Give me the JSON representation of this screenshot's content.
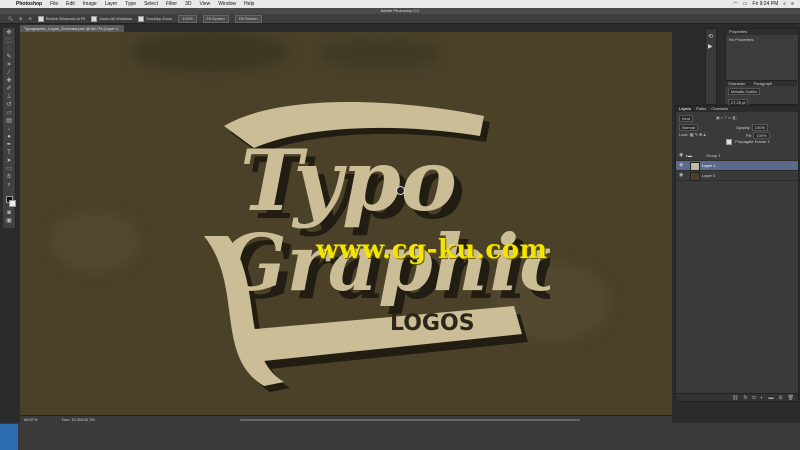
{
  "menubar": {
    "app": "Photoshop",
    "menus": [
      "File",
      "Edit",
      "Image",
      "Layer",
      "Type",
      "Select",
      "Filter",
      "3D",
      "View",
      "Window",
      "Help"
    ],
    "clock": "Fri 9:24 PM"
  },
  "window": {
    "title": "Adobe Photoshop CC"
  },
  "options": {
    "resize_windows": "Resize Windows to Fit",
    "zoom_all": "Zoom All Windows",
    "scrubby_zoom": "Scrubby Zoom",
    "btn_100": "100%",
    "btn_fit": "Fit Screen",
    "btn_fill": "Fill Screen"
  },
  "document": {
    "tab": "Typographic_Logos_Overcast.psd @ 66.7% (Layer 1, RGB/8) *",
    "zoom": "66.67%",
    "doc_size": "Doc: 10.0M/30.7M"
  },
  "artwork": {
    "line1": "Typo",
    "line2": "Graphic",
    "line3": "LOGOS",
    "colors": {
      "cream": "#cbbe96",
      "shadow": "#1f1c12",
      "background": "#4a4128"
    }
  },
  "watermark": {
    "text": "www.cg-ku.com",
    "color": "#f5e300"
  },
  "properties_panel": {
    "title": "Properties",
    "empty": "No Properties"
  },
  "character_panel": {
    "tabs": [
      "Character",
      "Paragraph"
    ],
    "font": "Metallic Gothic",
    "size": "27.25 pt"
  },
  "layers_panel": {
    "tabs": [
      "Layers",
      "Paths",
      "Channels"
    ],
    "kind_filter": "Kind",
    "blend_mode": "Normal",
    "opacity_label": "Opacity:",
    "opacity_value": "100%",
    "lock_label": "Lock:",
    "fill_label": "Fill:",
    "fill_value": "100%",
    "propagate": "Propagate Frame 1",
    "layers": [
      {
        "name": "Group 1",
        "selected": false
      },
      {
        "name": "Layer 1",
        "selected": true
      },
      {
        "name": "Layer 0",
        "selected": false
      }
    ]
  }
}
